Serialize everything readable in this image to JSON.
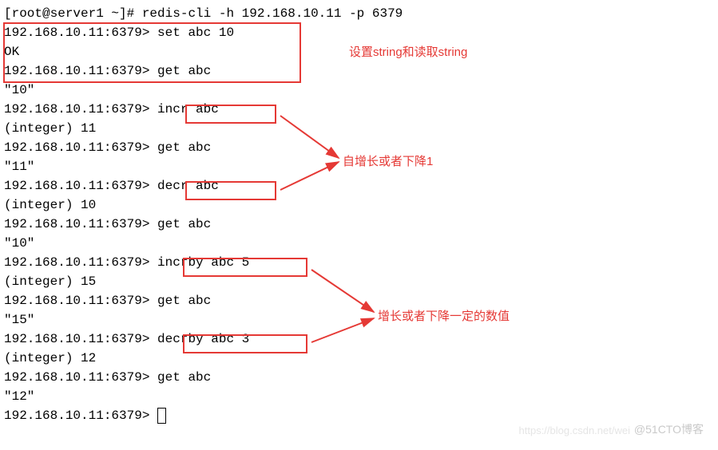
{
  "lines": {
    "l0": "[root@server1 ~]# redis-cli -h 192.168.10.11 -p 6379",
    "l1": "192.168.10.11:6379> set abc 10",
    "l2": "OK",
    "l3": "192.168.10.11:6379> get abc",
    "l4": "\"10\"",
    "l5": "192.168.10.11:6379> ",
    "cmd1": "incr abc",
    "l6": "(integer) 11",
    "l7": "192.168.10.11:6379> get abc",
    "l8": "\"11\"",
    "l9": "192.168.10.11:6379> ",
    "cmd2": "decr abc",
    "l10": "(integer) 10",
    "l11": "192.168.10.11:6379> get abc",
    "l12": "\"10\"",
    "l13": "192.168.10.11:6379> ",
    "cmd3": "incrby abc 5",
    "l14": "(integer) 15",
    "l15": "192.168.10.11:6379> get abc",
    "l16": "\"15\"",
    "l17": "192.168.10.11:6379> ",
    "cmd4": "decrby abc 3",
    "l18": "(integer) 12",
    "l19": "192.168.10.11:6379> get abc",
    "l20": "\"12\"",
    "l21": "192.168.10.11:6379> "
  },
  "annotations": {
    "a1": "设置string和读取string",
    "a2": "自增长或者下降1",
    "a3": "增长或者下降一定的数值"
  },
  "watermark": "@51CTO博客",
  "watermark2": "https://blog.csdn.net/wei"
}
